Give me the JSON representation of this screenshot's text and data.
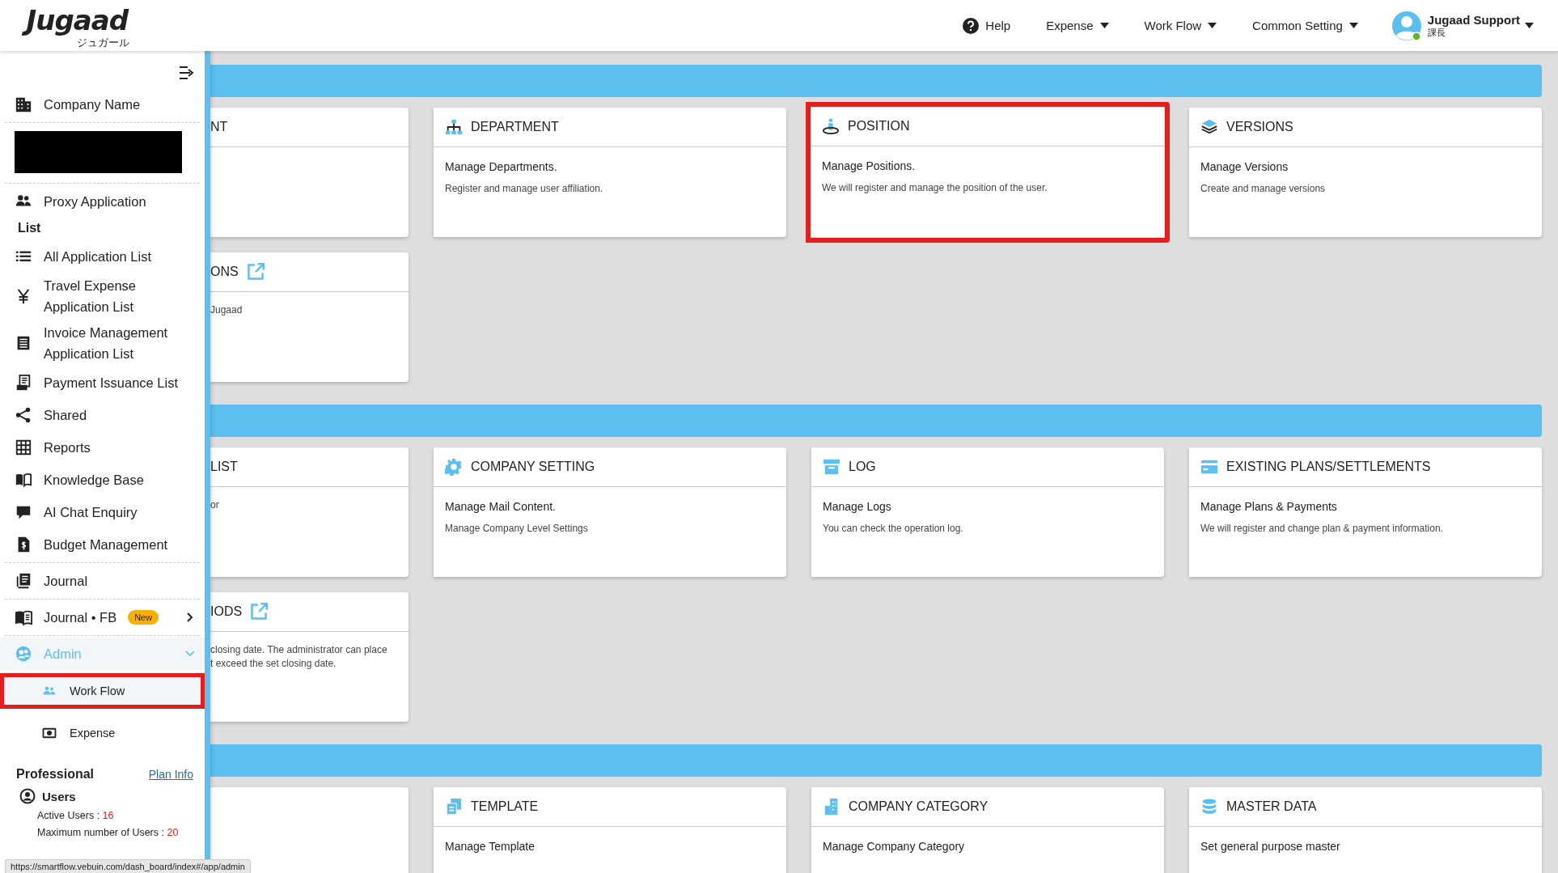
{
  "header": {
    "logo": "Jugaad",
    "logo_sub": "ジュガール",
    "nav": [
      {
        "kind": "help",
        "label": "Help"
      },
      {
        "kind": "menu",
        "label": "Expense"
      },
      {
        "kind": "menu",
        "label": "Work Flow"
      },
      {
        "kind": "menu",
        "label": "Common Setting"
      }
    ],
    "user": {
      "name": "Jugaad Support",
      "role": "課長",
      "online": true
    }
  },
  "sidebar": {
    "company": "Company Name",
    "items": [
      {
        "kind": "item",
        "label": "Proxy Application"
      },
      {
        "kind": "heading",
        "label": "List"
      },
      {
        "kind": "item",
        "label": "All Application List"
      },
      {
        "kind": "item",
        "label": "Travel Expense\nApplication List"
      },
      {
        "kind": "item",
        "label": "Invoice Management\nApplication List"
      },
      {
        "kind": "item",
        "label": "Payment Issuance List"
      },
      {
        "kind": "item",
        "label": "Shared"
      },
      {
        "kind": "item",
        "label": "Reports"
      },
      {
        "kind": "item",
        "label": "Knowledge Base"
      },
      {
        "kind": "item",
        "label": "AI Chat Enquiry"
      },
      {
        "kind": "item",
        "label": "Budget Management"
      },
      {
        "kind": "item",
        "label": "Journal",
        "divider_before": true
      },
      {
        "kind": "item",
        "label": "Journal • FB",
        "badge": "New",
        "submenu": true,
        "divider_before": true
      },
      {
        "kind": "group",
        "label": "Admin",
        "expanded": true,
        "divider_before": true,
        "children": [
          {
            "label": "Work Flow",
            "selected": true,
            "highlighted": true
          },
          {
            "label": "Expense",
            "selected": false
          }
        ]
      }
    ],
    "plan": {
      "name": "Professional",
      "link": "Plan Info"
    },
    "users": {
      "title": "Users",
      "stats": [
        {
          "label": "Active Users : ",
          "value": "16"
        },
        {
          "label": "Maximum number of Users : ",
          "value": "20"
        }
      ]
    }
  },
  "sections": [
    {
      "cards": [
        {
          "title": "NT"
        },
        {
          "title": "DEPARTMENT",
          "heading": "Manage Departments.",
          "description": [
            "Register and manage user affiliation."
          ]
        },
        {
          "title": "POSITION",
          "highlighted": true,
          "heading": "Manage Positions.",
          "description": [
            "We will register and manage the position of the user."
          ]
        },
        {
          "title": "VERSIONS",
          "heading": "Manage Versions",
          "description": [
            "Create and manage versions"
          ]
        },
        {
          "title": "ONS",
          "external": true,
          "description": [
            "Jugaad"
          ]
        }
      ]
    },
    {
      "cards": [
        {
          "title": "LIST",
          "description": [
            "or"
          ]
        },
        {
          "title": "COMPANY SETTING",
          "heading": "Manage Mail Content.",
          "description": [
            "Manage Company Level Settings"
          ]
        },
        {
          "title": "LOG",
          "heading": "Manage Logs",
          "description": [
            "You can check the operation log."
          ]
        },
        {
          "title": "EXISTING PLANS/SETTLEMENTS",
          "heading": "Manage Plans & Payments",
          "description": [
            "We will register and change plan & payment information."
          ]
        },
        {
          "title": "IODS",
          "external": true,
          "description": [
            "closing date. The administrator can place",
            "t exceed the set closing date."
          ]
        }
      ]
    },
    {
      "leading_blank": true,
      "cards": [
        {
          "title": "TEMPLATE",
          "heading": "Manage Template"
        },
        {
          "title": "COMPANY CATEGORY",
          "heading": "Manage Company Category"
        },
        {
          "title": "MASTER DATA",
          "heading": "Set general purpose master"
        }
      ]
    }
  ],
  "status_url": "https://smartflow.vebuin.com/dash_board/index#/app/admin"
}
